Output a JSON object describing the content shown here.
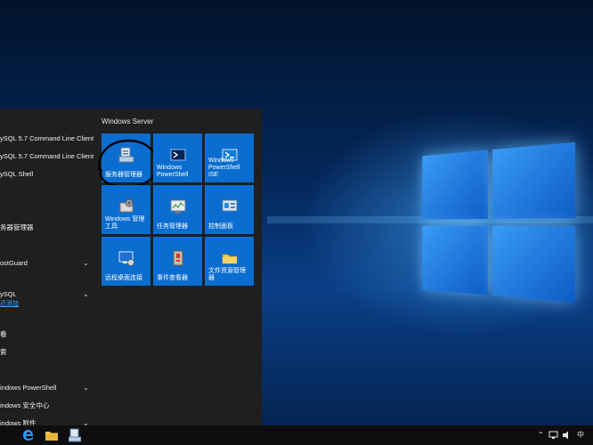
{
  "app_list": {
    "items": [
      {
        "label": "ySQL 5.7 Command Line Client",
        "chevron": ""
      },
      {
        "label": "ySQL 5.7 Command Line Client...",
        "chevron": ""
      },
      {
        "label": "ySQL Shell",
        "chevron": ""
      },
      {
        "label": "务器管理器",
        "chevron": ""
      },
      {
        "label": "ostGuard",
        "chevron": "⌄"
      },
      {
        "label": "ySQL",
        "chevron": "⌄"
      },
      {
        "label": "看",
        "chevron": ""
      },
      {
        "label": "索",
        "chevron": ""
      },
      {
        "label": "indows PowerShell",
        "chevron": "⌄"
      },
      {
        "label": "indows 安全中心",
        "chevron": ""
      },
      {
        "label": "indows 附件",
        "chevron": "⌄"
      }
    ],
    "recently_added": "近添加"
  },
  "tiles": {
    "group_title": "Windows Server",
    "items": [
      {
        "label": "服务器管理器",
        "icon": "server-manager-icon"
      },
      {
        "label": "Windows PowerShell",
        "icon": "powershell-icon"
      },
      {
        "label": "Windows PowerShell ISE",
        "icon": "powershell-ise-icon"
      },
      {
        "label": "Windows 管理工具",
        "icon": "admin-tools-icon"
      },
      {
        "label": "任务管理器",
        "icon": "task-manager-icon"
      },
      {
        "label": "控制面板",
        "icon": "control-panel-icon"
      },
      {
        "label": "远程桌面连接",
        "icon": "remote-desktop-icon"
      },
      {
        "label": "事件查看器",
        "icon": "event-viewer-icon"
      },
      {
        "label": "文件资源管理器",
        "icon": "file-explorer-icon"
      }
    ]
  },
  "taskbar": {
    "apps": [
      "edge-icon",
      "file-explorer-icon",
      "server-manager-icon"
    ],
    "tray_language": "中"
  },
  "colors": {
    "tile": "#0a6dcf",
    "start_bg": "#1f1f1f",
    "taskbar": "#0e0e10",
    "link": "#3ea6ff"
  }
}
